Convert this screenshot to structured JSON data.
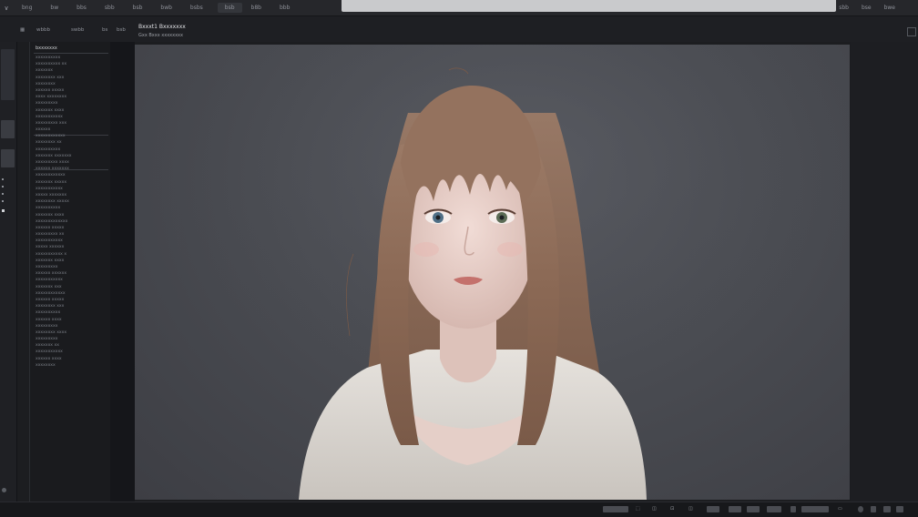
{
  "menubar": {
    "logo_glyph": "∨",
    "items": [
      "bng",
      "bw",
      "bbs",
      "sbb",
      "bsb",
      "bwb",
      "bsbs",
      "bsb",
      "b8b",
      "bbb"
    ],
    "right_items": [
      "sbb",
      "bse",
      "bwe"
    ]
  },
  "toolbar": {
    "items": [
      "wbbb",
      "swbb",
      "bs",
      "bsb"
    ],
    "document_title": "Bxxxt1 Bxxxxxxx",
    "document_subtitle": "Gxx Bxxx xxxxxxxx"
  },
  "left_panel": {
    "header": "bxxxxxxx",
    "rows": [
      "xxxxxxxxxx",
      "xxxxxxxxxx xx",
      "xxxxxxx",
      "xxxxxxxx xxx",
      "xxxxxxxx",
      "xxxxxx xxxxx",
      "xxxx xxxxxxxx",
      "xxxxxxxxx",
      "xxxxxxx xxxx",
      "xxxxxxxxxxx",
      "xxxxxxxxx xxx",
      "xxxxxx",
      "xxxxxxxxxxxx",
      "xxxxxxxx xx",
      "xxxxxxxxxx",
      "xxxxxxx xxxxxxx",
      "xxxxxxxxx xxxx",
      "xxxxxx xxxxxxx",
      "xxxxxxxxxxxx",
      "xxxxxxx xxxxx",
      "xxxxxxxxxxx",
      "xxxxx xxxxxxx",
      "xxxxxxxx xxxxx",
      "xxxxxxxxxx",
      "xxxxxxx xxxx",
      "xxxxxxxxxxxxx",
      "xxxxxx xxxxx",
      "xxxxxxxxx xx",
      "xxxxxxxxxxx",
      "xxxxx xxxxxx",
      "xxxxxxxxxxx x",
      "xxxxxxx xxxx",
      "xxxxxxxxx",
      "xxxxxx xxxxxx",
      "xxxxxxxxxxx",
      "xxxxxxx xxx",
      "xxxxxxxxxxxx",
      "xxxxxx xxxxx",
      "xxxxxxxx xxx",
      "xxxxxxxxxx",
      "xxxxxx xxxx",
      "xxxxxxxxx",
      "xxxxxxxx xxxx",
      "xxxxxxxxx",
      "xxxxxxx xx",
      "xxxxxxxxxxx",
      "xxxxxx xxxx",
      "xxxxxxxx"
    ]
  },
  "status_bar": {
    "items": [
      "⬚",
      "◫",
      "⊡",
      "◫",
      "▭"
    ]
  },
  "colors": {
    "canvas_bg": "#4a4c52",
    "hair": "#8a6a55",
    "skin": "#e8d2cc",
    "sweater": "#d8d4cf",
    "chrome": "#1c1d20"
  }
}
